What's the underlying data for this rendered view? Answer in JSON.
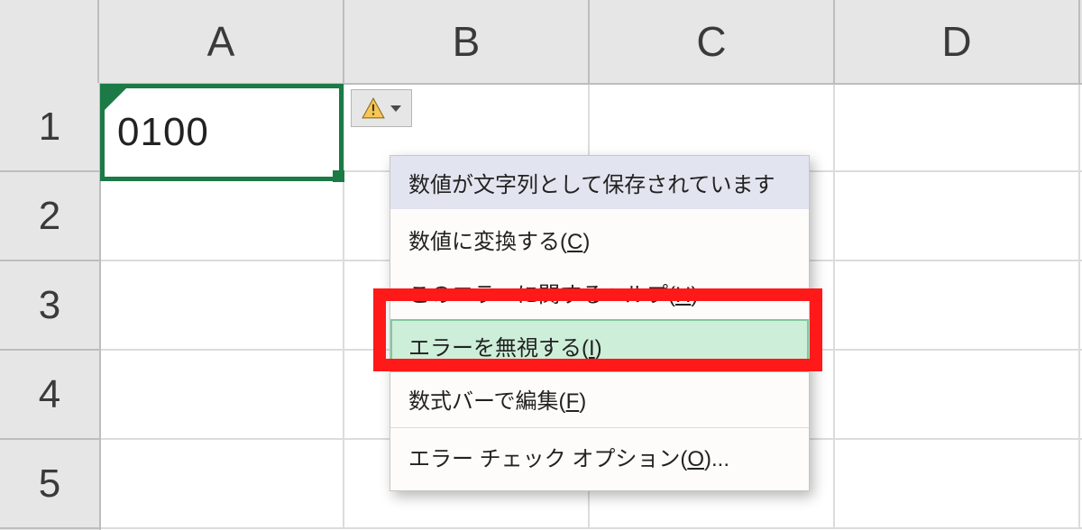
{
  "columns": [
    "A",
    "B",
    "C",
    "D"
  ],
  "rows": [
    "1",
    "2",
    "3",
    "4",
    "5"
  ],
  "cell_A1": {
    "value": "0100"
  },
  "error_button": {
    "icon": "warning-icon",
    "has_dropdown": true
  },
  "menu": {
    "header": "数値が文字列として保存されています",
    "items": [
      {
        "label": "数値に変換する(",
        "accel": "C",
        "suffix": ")"
      },
      {
        "label": "このエラーに関するヘルプ(",
        "accel": "H",
        "suffix": ")"
      },
      {
        "label": "エラーを無視する(",
        "accel": "I",
        "suffix": ")",
        "highlighted": true
      },
      {
        "label": "数式バーで編集(",
        "accel": "F",
        "suffix": ")"
      },
      {
        "label": "エラー チェック オプション(",
        "accel": "O",
        "suffix": ")..."
      }
    ]
  }
}
